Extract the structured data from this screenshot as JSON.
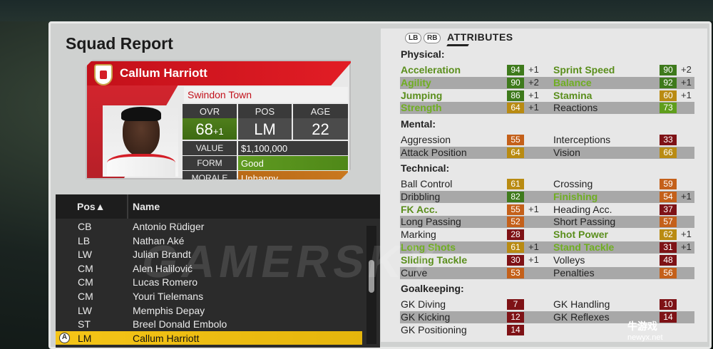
{
  "screen": {
    "title": "Squad Report"
  },
  "player": {
    "name": "Callum Harriott",
    "club": "Swindon Town",
    "headers": {
      "ovr": "OVR",
      "pos": "POS",
      "age": "AGE"
    },
    "ovr": "68",
    "ovr_delta": "+1",
    "pos": "LM",
    "age": "22",
    "value_label": "VALUE",
    "value": "$1,100,000",
    "form_label": "FORM",
    "form": "Good",
    "morale_label": "MORALE",
    "morale": "Unhappy"
  },
  "squad_list": {
    "col_pos": "Pos▲",
    "col_name": "Name",
    "button_hint": "A",
    "rows": [
      {
        "pos": "CB",
        "name": "Antonio Rüdiger"
      },
      {
        "pos": "LB",
        "name": "Nathan Aké"
      },
      {
        "pos": "LW",
        "name": "Julian Brandt"
      },
      {
        "pos": "CM",
        "name": "Alen Halilović"
      },
      {
        "pos": "CM",
        "name": "Lucas Romero"
      },
      {
        "pos": "CM",
        "name": "Youri Tielemans"
      },
      {
        "pos": "LW",
        "name": "Memphis Depay"
      },
      {
        "pos": "ST",
        "name": "Breel Donald Embolo"
      },
      {
        "pos": "LM",
        "name": "Callum Harriott"
      }
    ]
  },
  "attributes": {
    "btn_lb": "LB",
    "btn_rb": "RB",
    "title": "ATTRIBUTES",
    "sections": {
      "physical": "Physical:",
      "mental": "Mental:",
      "technical": "Technical:",
      "goalkeeping": "Goalkeeping:"
    },
    "rows": [
      {
        "l": {
          "name": "Acceleration",
          "val": "94",
          "delta": "+1"
        },
        "r": {
          "name": "Sprint Speed",
          "val": "90",
          "delta": "+2"
        }
      },
      {
        "l": {
          "name": "Agility",
          "val": "90",
          "delta": "+2"
        },
        "r": {
          "name": "Balance",
          "val": "92",
          "delta": "+1"
        }
      },
      {
        "l": {
          "name": "Jumping",
          "val": "86",
          "delta": "+1"
        },
        "r": {
          "name": "Stamina",
          "val": "60",
          "delta": "+1"
        }
      },
      {
        "l": {
          "name": "Strength",
          "val": "64",
          "delta": "+1"
        },
        "r": {
          "name": "Reactions",
          "val": "73",
          "delta": ""
        }
      },
      {
        "l": {
          "name": "Aggression",
          "val": "55",
          "delta": ""
        },
        "r": {
          "name": "Interceptions",
          "val": "33",
          "delta": ""
        }
      },
      {
        "l": {
          "name": "Attack Position",
          "val": "64",
          "delta": ""
        },
        "r": {
          "name": "Vision",
          "val": "66",
          "delta": ""
        }
      },
      {
        "l": {
          "name": "Ball Control",
          "val": "61",
          "delta": ""
        },
        "r": {
          "name": "Crossing",
          "val": "59",
          "delta": ""
        }
      },
      {
        "l": {
          "name": "Dribbling",
          "val": "82",
          "delta": ""
        },
        "r": {
          "name": "Finishing",
          "val": "54",
          "delta": "+1"
        }
      },
      {
        "l": {
          "name": "FK Acc.",
          "val": "55",
          "delta": "+1"
        },
        "r": {
          "name": "Heading Acc.",
          "val": "37",
          "delta": ""
        }
      },
      {
        "l": {
          "name": "Long Passing",
          "val": "52",
          "delta": ""
        },
        "r": {
          "name": "Short Passing",
          "val": "57",
          "delta": ""
        }
      },
      {
        "l": {
          "name": "Marking",
          "val": "28",
          "delta": ""
        },
        "r": {
          "name": "Shot Power",
          "val": "62",
          "delta": "+1"
        }
      },
      {
        "l": {
          "name": "Long Shots",
          "val": "61",
          "delta": "+1"
        },
        "r": {
          "name": "Stand Tackle",
          "val": "31",
          "delta": "+1"
        }
      },
      {
        "l": {
          "name": "Sliding Tackle",
          "val": "30",
          "delta": "+1"
        },
        "r": {
          "name": "Volleys",
          "val": "48",
          "delta": ""
        }
      },
      {
        "l": {
          "name": "Curve",
          "val": "53",
          "delta": ""
        },
        "r": {
          "name": "Penalties",
          "val": "56",
          "delta": ""
        }
      },
      {
        "l": {
          "name": "GK Diving",
          "val": "7",
          "delta": ""
        },
        "r": {
          "name": "GK Handling",
          "val": "10",
          "delta": ""
        }
      },
      {
        "l": {
          "name": "GK Kicking",
          "val": "12",
          "delta": ""
        },
        "r": {
          "name": "GK Reflexes",
          "val": "14",
          "delta": ""
        }
      },
      {
        "l": {
          "name": "GK Positioning",
          "val": "14",
          "delta": ""
        },
        "r": null
      }
    ]
  },
  "colors": {
    "rating_green": "#3e7a1c",
    "rating_lime": "#5f9e1c",
    "rating_gold": "#b98b12",
    "rating_orange": "#c4601a",
    "rating_red": "#7e1216",
    "selected_row": "#f5c518",
    "header_red": "#d9161f",
    "improved_text": "#5a8e1c"
  },
  "watermark": "GAMERSKY",
  "corner_logo": {
    "cn": "牛游戏",
    "url": "newyx.net"
  }
}
